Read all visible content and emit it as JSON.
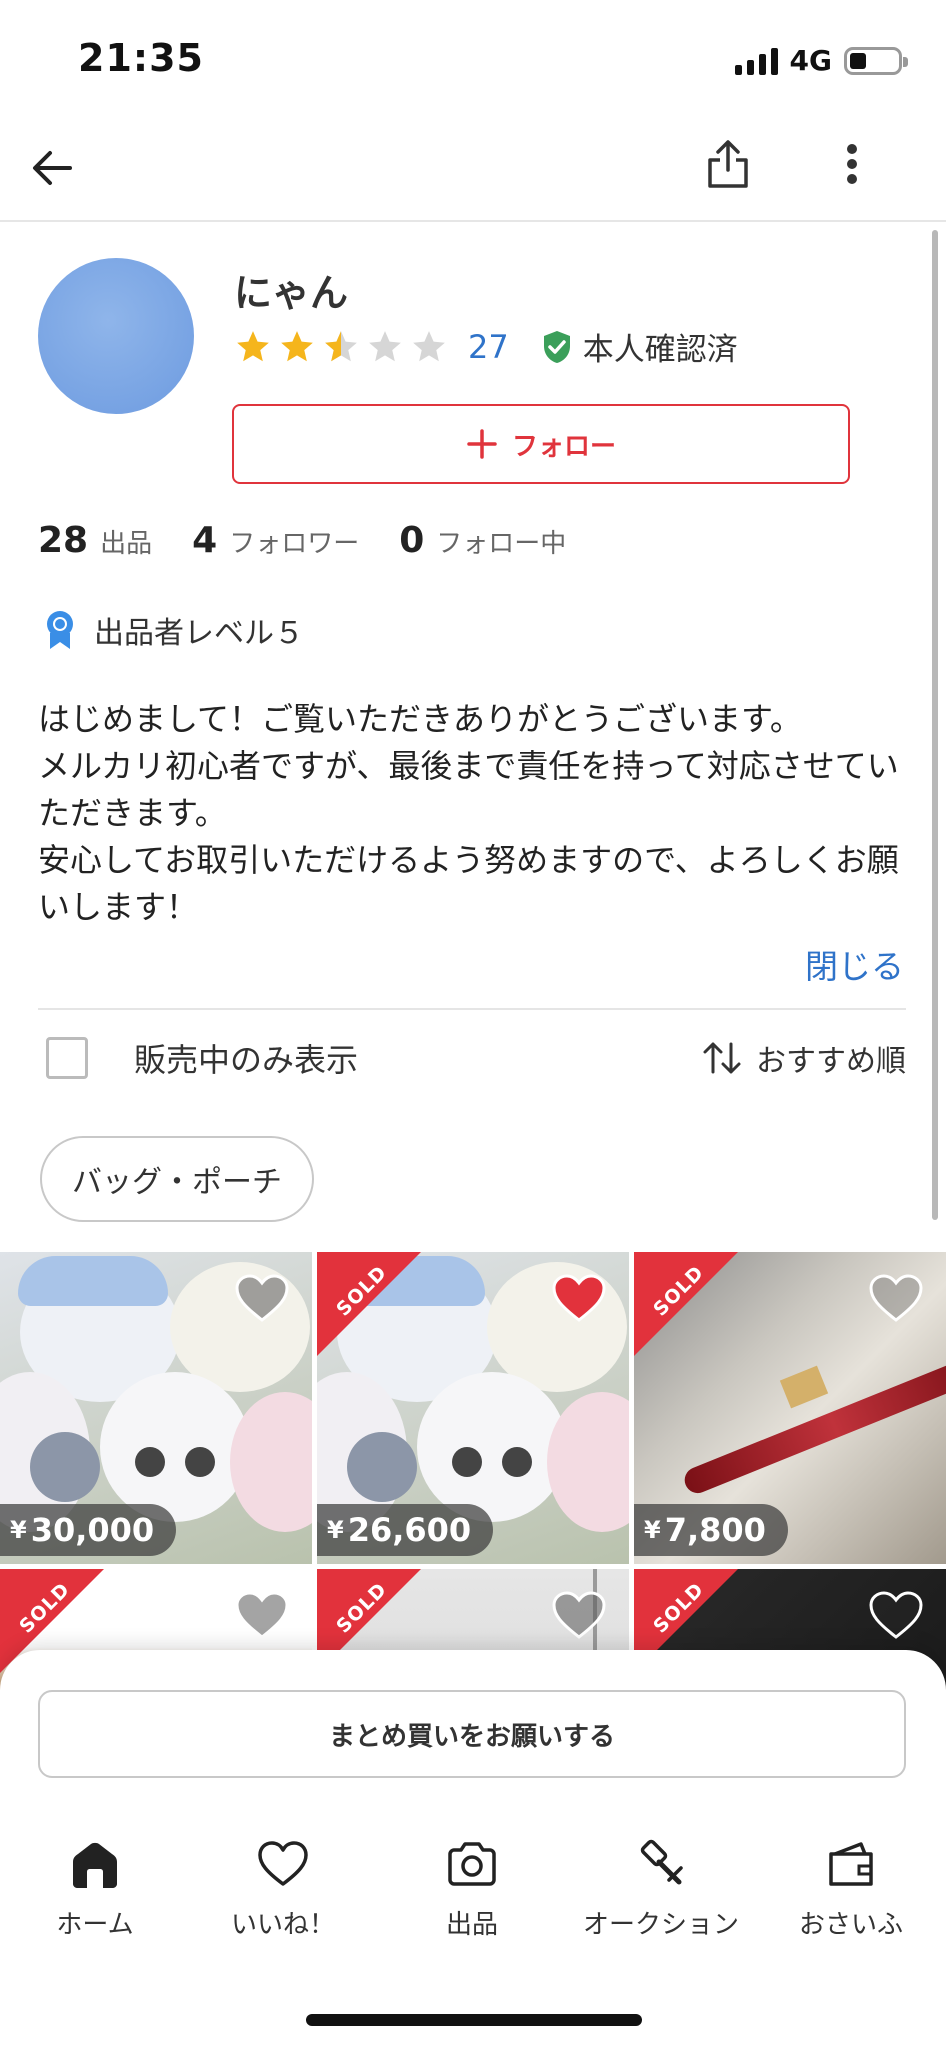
{
  "status_bar": {
    "time": "21:35",
    "network": "4G"
  },
  "profile": {
    "username": "にゃん",
    "rating_stars": 2.5,
    "review_count": "27",
    "verified_label": "本人確認済",
    "follow_label": "フォロー",
    "stats": [
      {
        "num": "28",
        "label": "出品"
      },
      {
        "num": "4",
        "label": "フォロワー"
      },
      {
        "num": "0",
        "label": "フォロー中"
      }
    ],
    "level_label": "出品者レベル５",
    "bio": "はじめまして！ご覧いただきありがとうございます。\nメルカリ初心者ですが、最後まで責任を持って対応させていただきます。\n安心してお取引いただけるよう努めますので、よろしくお願いします！",
    "close_label": "閉じる"
  },
  "filter": {
    "on_sale_only_label": "販売中のみ表示",
    "sort_label": "おすすめ順",
    "category_chip": "バッグ・ポーチ"
  },
  "products": [
    {
      "price": "30,000",
      "sold": false,
      "liked": false
    },
    {
      "price": "26,600",
      "sold": true,
      "liked": true
    },
    {
      "price": "7,800",
      "sold": true,
      "liked": false
    },
    {
      "price": "",
      "sold": true,
      "liked": false
    },
    {
      "price": "",
      "sold": true,
      "liked": false
    },
    {
      "price": "",
      "sold": true,
      "liked": false
    }
  ],
  "sold_label": "SOLD",
  "yen_symbol": "¥",
  "bulk_purchase_label": "まとめ買いをお願いする",
  "tabbar": [
    {
      "label": "ホーム",
      "icon": "home-icon"
    },
    {
      "label": "いいね！",
      "icon": "heart-icon"
    },
    {
      "label": "出品",
      "icon": "camera-icon"
    },
    {
      "label": "オークション",
      "icon": "gavel-icon"
    },
    {
      "label": "おさいふ",
      "icon": "wallet-icon"
    }
  ],
  "colors": {
    "accent_red": "#e0343c",
    "link_blue": "#2f73c9",
    "star_gold": "#f5b51c",
    "verified_green": "#3b9f5a"
  }
}
